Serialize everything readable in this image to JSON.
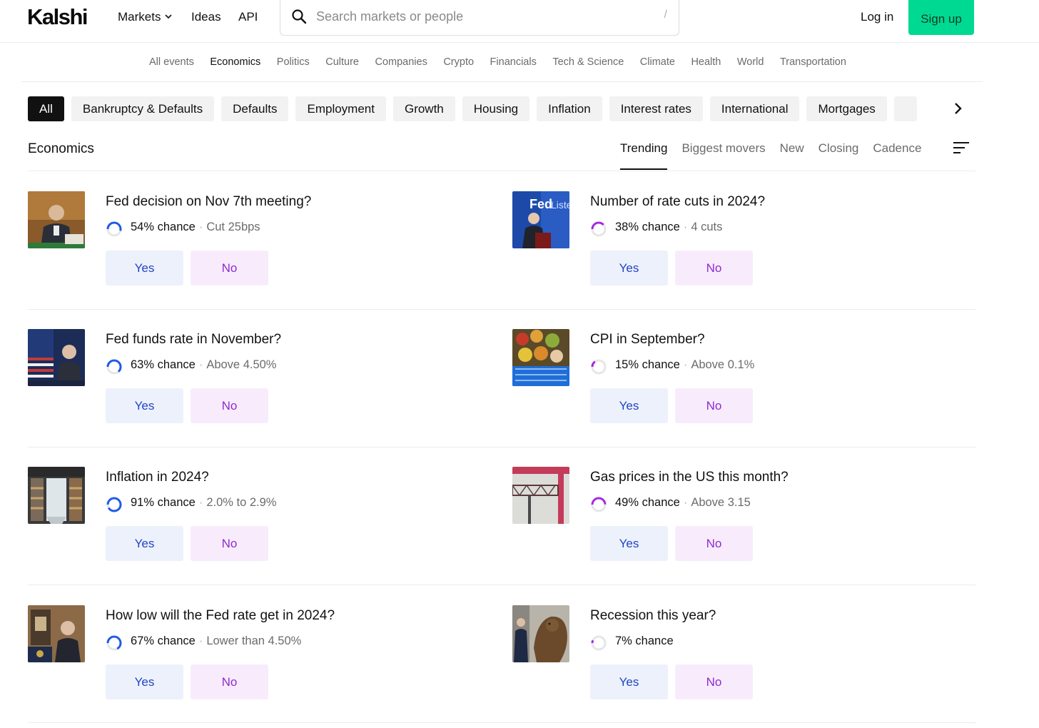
{
  "header": {
    "logo": "Kalshi",
    "nav": [
      "Markets",
      "Ideas",
      "API"
    ],
    "search_placeholder": "Search markets or people",
    "search_shortcut": "/",
    "login": "Log in",
    "signup": "Sign up"
  },
  "categories": {
    "items": [
      "All events",
      "Economics",
      "Politics",
      "Culture",
      "Companies",
      "Crypto",
      "Financials",
      "Tech & Science",
      "Climate",
      "Health",
      "World",
      "Transportation"
    ],
    "active": "Economics"
  },
  "filters": {
    "items": [
      "All",
      "Bankruptcy & Defaults",
      "Defaults",
      "Employment",
      "Growth",
      "Housing",
      "Inflation",
      "Interest rates",
      "International",
      "Mortgages"
    ],
    "active": "All"
  },
  "section": {
    "title": "Economics",
    "sorts": [
      "Trending",
      "Biggest movers",
      "New",
      "Closing",
      "Cadence"
    ],
    "active_sort": "Trending"
  },
  "colors": {
    "accent_green": "#00d991",
    "yes_text": "#2244c4",
    "yes_bg": "#edf1fc",
    "no_text": "#8e2ad1",
    "no_bg": "#f8ecfc",
    "ring_blue": "#1f5ce6",
    "ring_purple": "#a52ae0"
  },
  "markets": [
    {
      "question": "Fed decision on Nov 7th meeting?",
      "chance": "54% chance",
      "probability": 0.54,
      "outcome": "Cut 25bps",
      "yes": "Yes",
      "no": "No",
      "ring": "blue",
      "image": "speaker-at-podium-photo"
    },
    {
      "question": "Number of rate cuts in 2024?",
      "chance": "38% chance",
      "probability": 0.38,
      "outcome": "4 cuts",
      "yes": "Yes",
      "no": "No",
      "ring": "purple",
      "image": "fedlistens-speaker-photo"
    },
    {
      "question": "Fed funds rate in November?",
      "chance": "63% chance",
      "probability": 0.63,
      "outcome": "Above 4.50%",
      "yes": "Yes",
      "no": "No",
      "ring": "blue",
      "image": "speaker-with-flag-photo"
    },
    {
      "question": "CPI in September?",
      "chance": "15% chance",
      "probability": 0.15,
      "outcome": "Above 0.1%",
      "yes": "Yes",
      "no": "No",
      "ring": "purple",
      "image": "produce-market-photo"
    },
    {
      "question": "Inflation in 2024?",
      "chance": "91% chance",
      "probability": 0.91,
      "outcome": "2.0% to 2.9%",
      "yes": "Yes",
      "no": "No",
      "ring": "blue",
      "image": "grocery-aisle-photo"
    },
    {
      "question": "Gas prices in the US this month?",
      "chance": "49% chance",
      "probability": 0.49,
      "outcome": "Above 3.15",
      "yes": "Yes",
      "no": "No",
      "ring": "purple",
      "image": "gas-station-canopy-photo"
    },
    {
      "question": "How low will the Fed rate get in 2024?",
      "chance": "67% chance",
      "probability": 0.67,
      "outcome": "Lower than 4.50%",
      "yes": "Yes",
      "no": "No",
      "ring": "blue",
      "image": "speaker-at-lectern-photo"
    },
    {
      "question": "Recession this year?",
      "chance": "7% chance",
      "probability": 0.07,
      "outcome": "",
      "yes": "Yes",
      "no": "No",
      "ring": "purple",
      "image": "bull-statue-photo"
    }
  ]
}
